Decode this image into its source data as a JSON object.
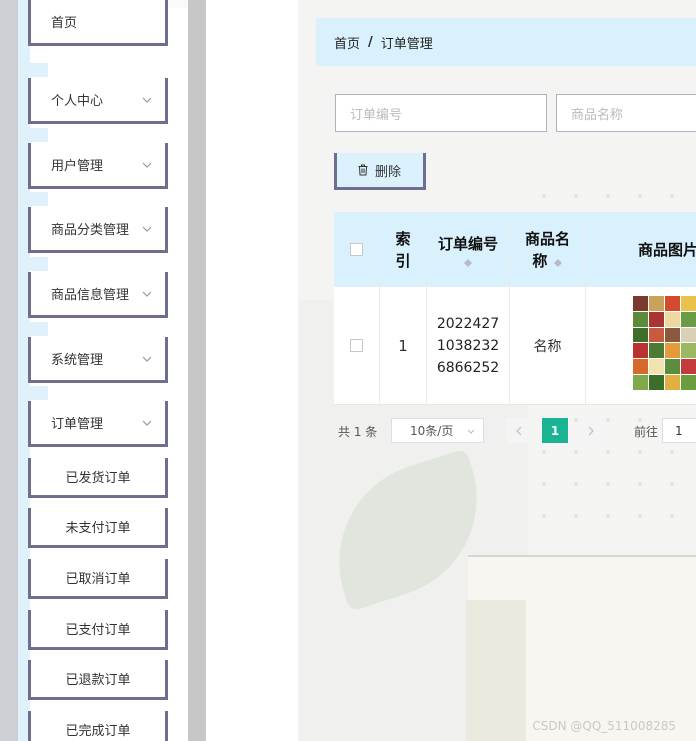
{
  "sidebar": {
    "menu": [
      {
        "label": "首页",
        "has_chevron": false
      },
      {
        "label": "个人中心",
        "has_chevron": true
      },
      {
        "label": "用户管理",
        "has_chevron": true
      },
      {
        "label": "商品分类管理",
        "has_chevron": true
      },
      {
        "label": "商品信息管理",
        "has_chevron": true
      },
      {
        "label": "系统管理",
        "has_chevron": true
      },
      {
        "label": "订单管理",
        "has_chevron": true
      }
    ],
    "submenu": [
      "已发货订单",
      "未支付订单",
      "已取消订单",
      "已支付订单",
      "已退款订单",
      "已完成订单"
    ]
  },
  "breadcrumb": {
    "home": "首页",
    "separator": "/",
    "current": "订单管理"
  },
  "search": {
    "order_no_placeholder": "订单编号",
    "product_name_placeholder": "商品名称"
  },
  "toolbar": {
    "delete_label": "删除"
  },
  "table": {
    "headers": {
      "index_line1": "索",
      "index_line2": "引",
      "order_no": "订单编号",
      "product_name_line1": "商品名",
      "product_name_line2": "称",
      "product_image": "商品图片"
    },
    "rows": [
      {
        "index": "1",
        "order_no_line1": "2022427",
        "order_no_line2": "1038232",
        "order_no_line3": "6866252",
        "product_name": "名称"
      }
    ]
  },
  "pagination": {
    "total_text": "共 1 条",
    "page_size": "10条/页",
    "current_page": "1",
    "goto_label": "前往",
    "goto_value": "1"
  },
  "watermark": "CSDN @QQ_511008285",
  "colors": {
    "accent": "#1ab394",
    "header_bg": "#d9f1fd",
    "border_dark": "#6e6e8e"
  }
}
